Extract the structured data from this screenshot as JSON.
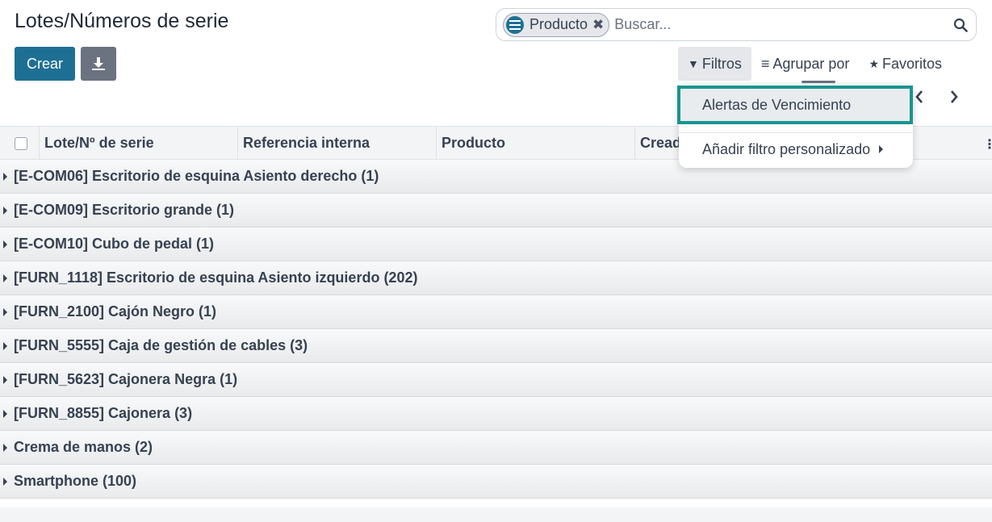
{
  "page": {
    "title": "Lotes/Números de serie"
  },
  "actions": {
    "create_label": "Crear",
    "download_icon": "download-icon"
  },
  "search": {
    "facet_label": "Producto",
    "facet_icon": "list-icon",
    "facet_remove": "✖",
    "placeholder": "Buscar...",
    "search_icon": "search-icon"
  },
  "toolbar": {
    "filters_label": "Filtros",
    "groupby_label": "Agrupar por",
    "favorites_label": "Favoritos",
    "filters_glyph": "▼",
    "groupby_glyph": "≡",
    "favorites_glyph": "★"
  },
  "filters_dropdown": {
    "items": [
      {
        "label": "Alertas de Vencimiento"
      },
      {
        "label": "Añadir filtro personalizado"
      }
    ]
  },
  "table": {
    "columns": [
      "Lote/Nº de serie",
      "Referencia interna",
      "Producto",
      "Creado el"
    ],
    "more_columns_glyph": "⋮",
    "groups": [
      "[E-COM06] Escritorio de esquina Asiento derecho (1)",
      "[E-COM09] Escritorio grande (1)",
      "[E-COM10] Cubo de pedal (1)",
      "[FURN_1118] Escritorio de esquina Asiento izquierdo (202)",
      "[FURN_2100] Cajón Negro (1)",
      "[FURN_5555] Caja de gestión de cables (3)",
      "[FURN_5623] Cajonera Negra (1)",
      "[FURN_8855] Cajonera (3)",
      "Crema de manos (2)",
      "Smartphone (100)"
    ]
  },
  "colors": {
    "primary": "#1e6f94",
    "secondary": "#6b7280",
    "highlight": "#17968f"
  }
}
